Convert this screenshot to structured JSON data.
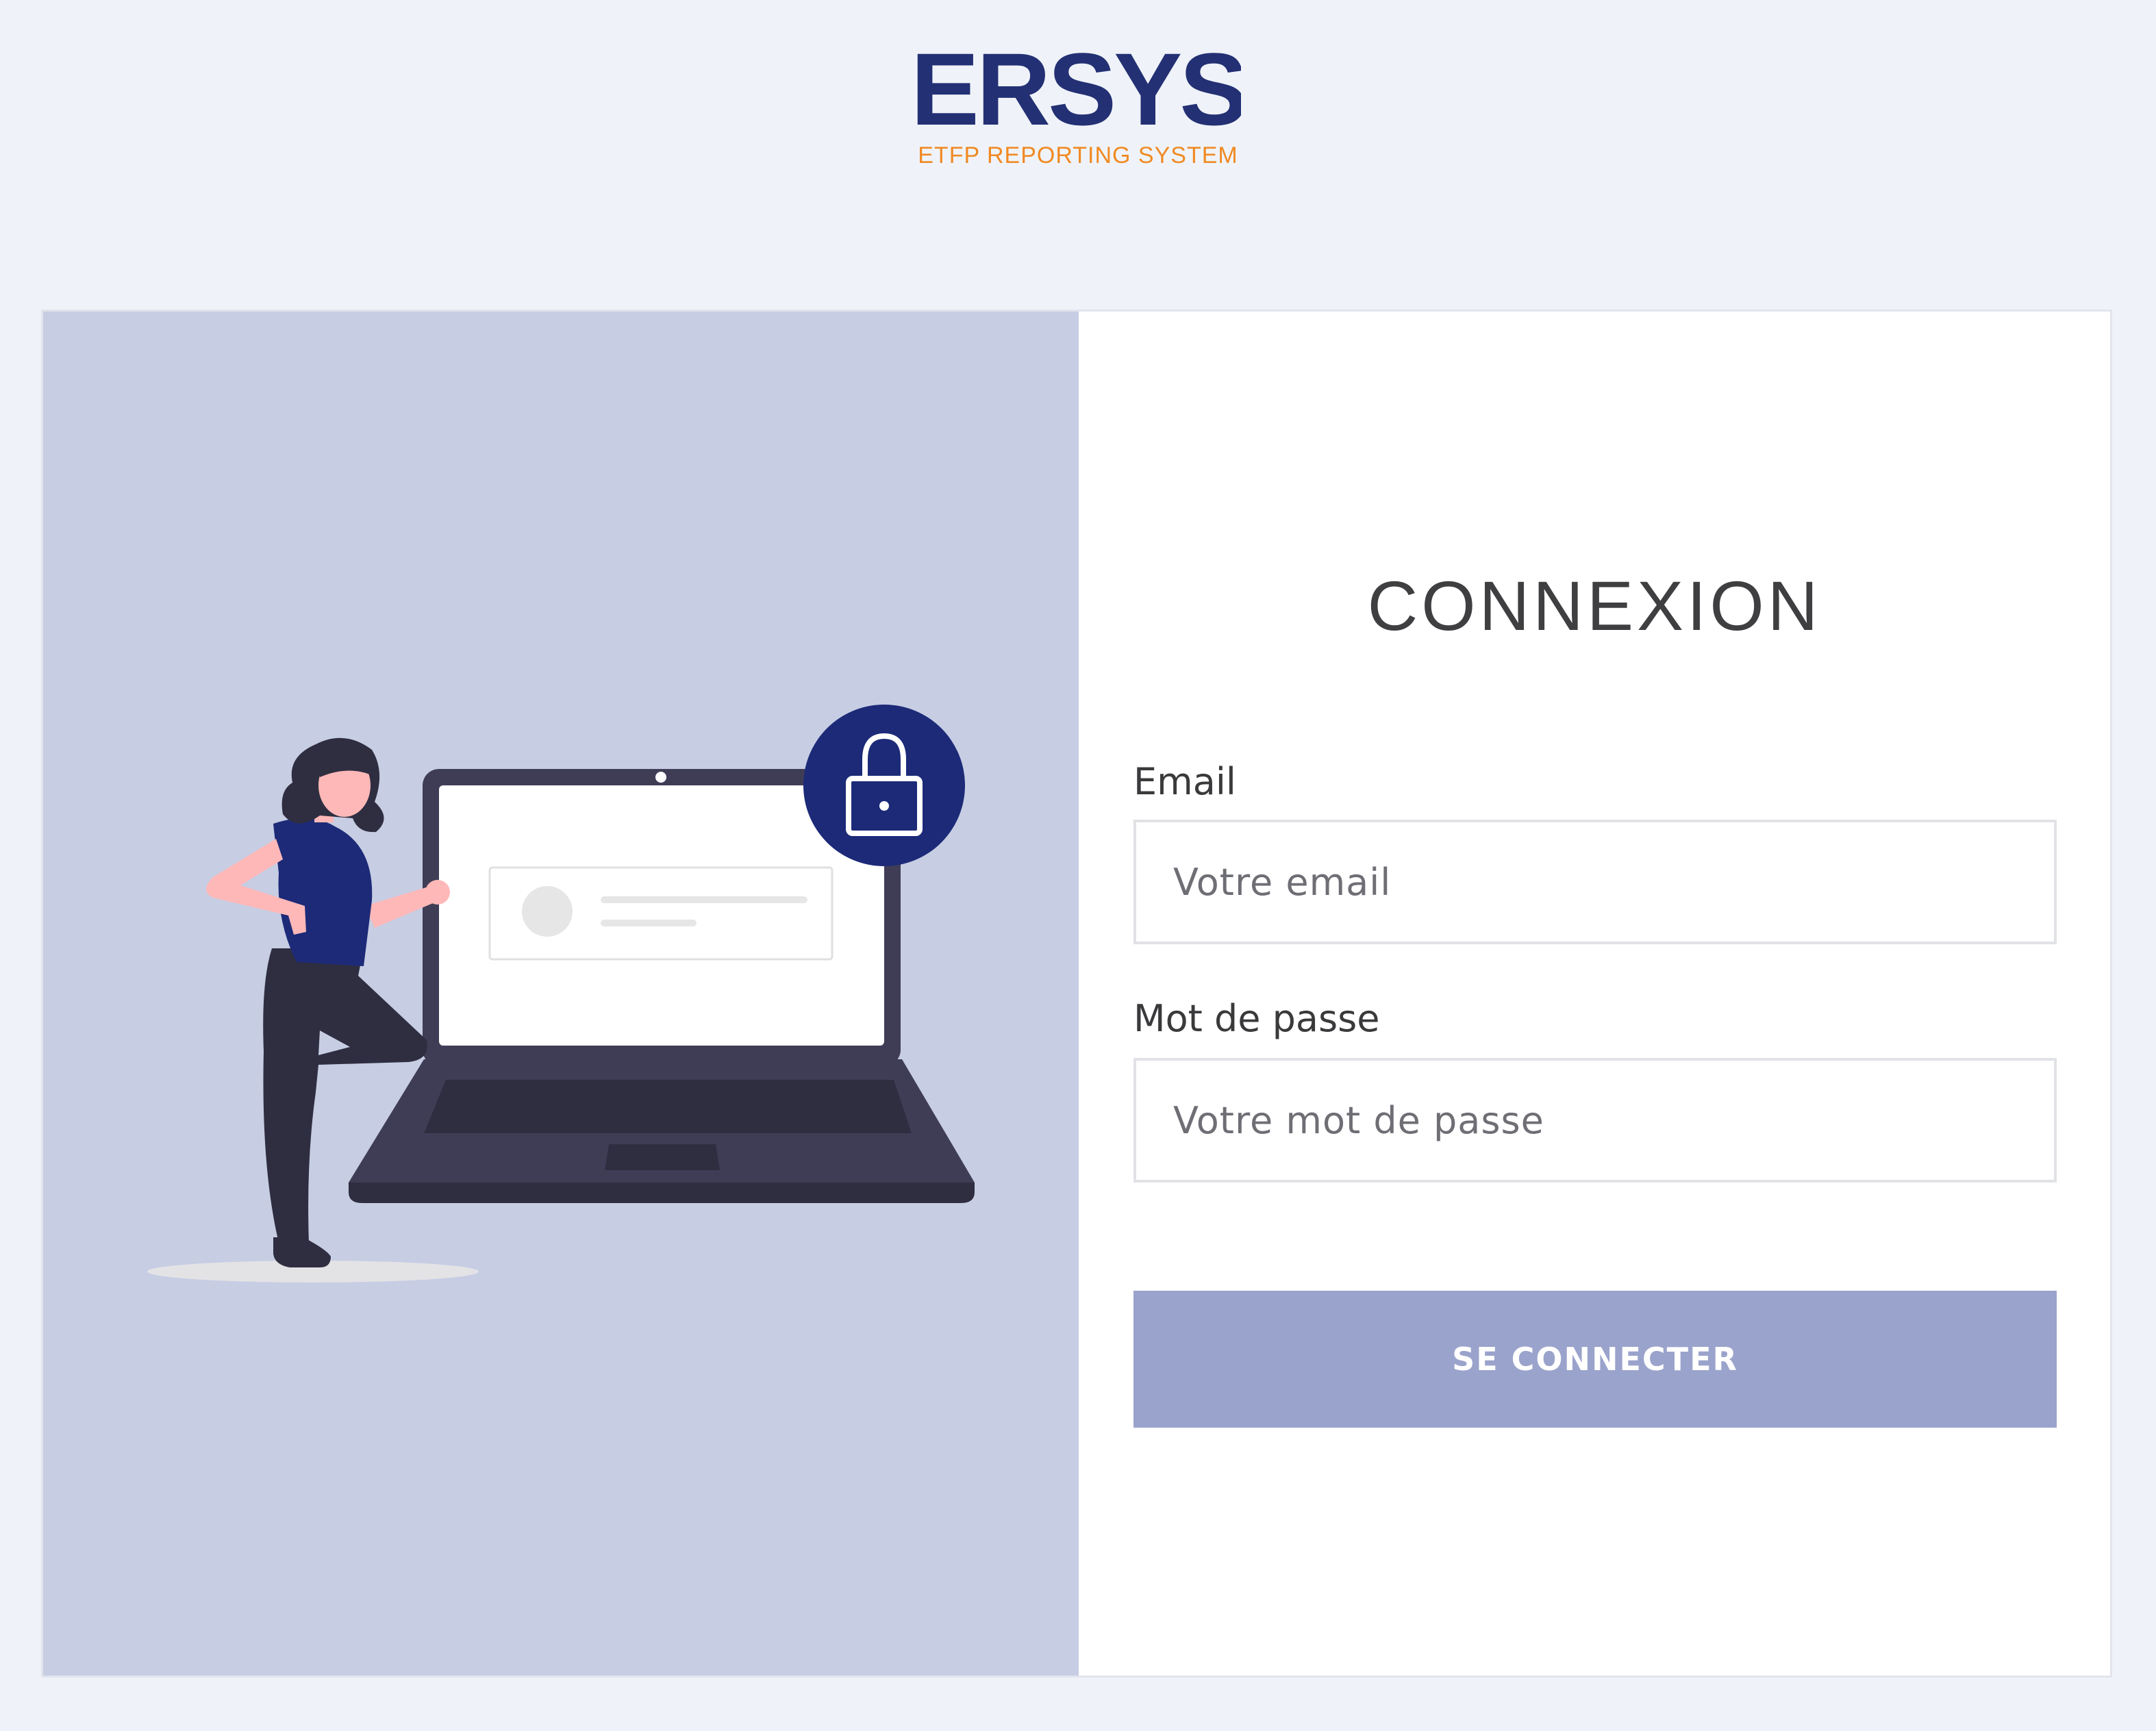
{
  "brand": {
    "logo_text": "ERSYS",
    "tagline": "ETFP REPORTING SYSTEM",
    "primary_color": "#233074",
    "accent_color": "#f08a24"
  },
  "login": {
    "title": "CONNEXION",
    "email_label": "Email",
    "email_placeholder": "Votre email",
    "password_label": "Mot de passe",
    "password_placeholder": "Votre mot de passe",
    "submit_label": "SE CONNECTER",
    "submit_color": "#9aa3cb"
  },
  "illustration": {
    "panel_color": "#c7cde3",
    "lock_color": "#1c2a78",
    "icons": [
      "woman-figure-icon",
      "laptop-icon",
      "lock-icon"
    ]
  }
}
